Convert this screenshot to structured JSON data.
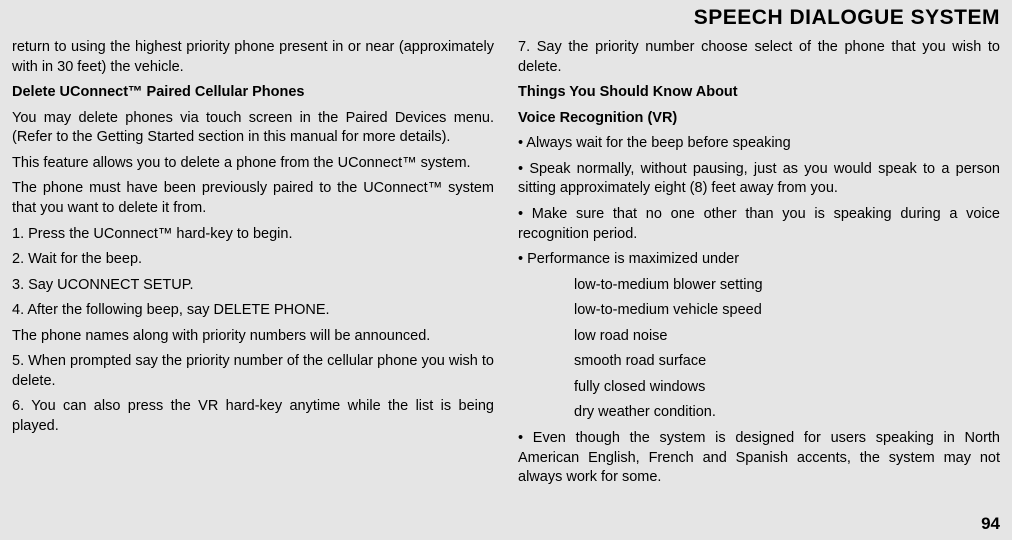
{
  "header": {
    "title": "SPEECH DIALOGUE SYSTEM"
  },
  "left": {
    "p1": "return to using the highest priority phone present in or near (approximately with in 30 feet) the vehicle.",
    "p2": "Delete UConnect™ Paired Cellular Phones",
    "p3": "You may delete phones via touch screen in the Paired Devices menu. (Refer to the Getting Started section in this manual for more details).",
    "p4": "This feature allows you to delete a phone from the UConnect™ system.",
    "p5": "The phone must have been previously paired to the UConnect™ system that you want to delete it from.",
    "p6": "1. Press the UConnect™ hard-key to begin.",
    "p7": "2. Wait for the beep.",
    "p8": "3. Say UCONNECT SETUP.",
    "p9": "4. After the following beep, say DELETE PHONE.",
    "p10": "The phone names along with priority numbers will be announced.",
    "p11": "5. When prompted say the priority number of the cellular phone you wish to delete.",
    "p12": "6. You can also press the VR hard-key anytime while the list is being played."
  },
  "right": {
    "p1": "7. Say the priority number choose select of the phone that you wish to delete.",
    "p2": "Things You Should Know About",
    "p3": "Voice Recognition (VR)",
    "p4": "• Always wait for the beep before speaking",
    "p5": "• Speak normally, without pausing, just as you would speak to a person sitting approximately eight (8) feet away from you.",
    "p6": "• Make sure that no one other than you is speaking during a voice recognition period.",
    "p7": "• Performance is maximized under",
    "i1": "low-to-medium blower setting",
    "i2": "low-to-medium vehicle speed",
    "i3": "low road noise",
    "i4": "smooth road surface",
    "i5": "fully closed windows",
    "i6": "dry weather condition.",
    "p8": "• Even though the system is designed for users speaking in North American English, French and Spanish accents, the system may not always work for some."
  },
  "footer": {
    "page": "94"
  }
}
